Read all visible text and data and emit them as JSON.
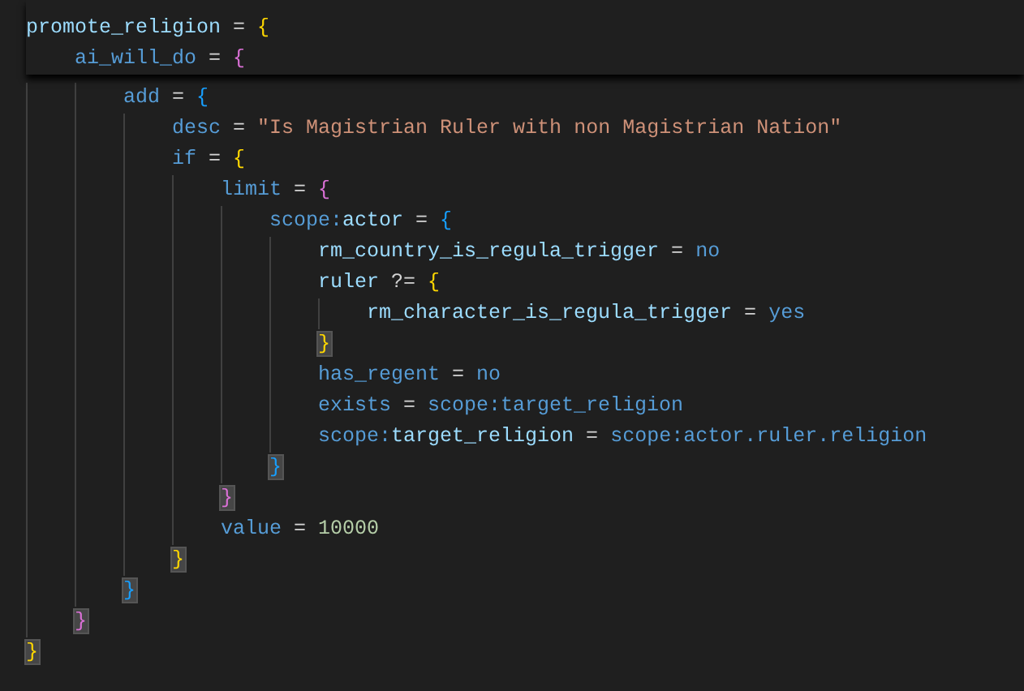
{
  "sticky_header": [
    [
      {
        "kind": "name",
        "text": "promote_religion"
      },
      {
        "kind": "op",
        "text": " = "
      },
      {
        "kind": "open",
        "text": "{"
      }
    ],
    [
      {
        "kind": "keyword",
        "text": "ai_will_do"
      },
      {
        "kind": "op",
        "text": " = "
      },
      {
        "kind": "open",
        "text": "{"
      }
    ]
  ],
  "lines": [
    [
      {
        "kind": "keyword",
        "text": "add"
      },
      {
        "kind": "op",
        "text": " = "
      },
      {
        "kind": "open",
        "text": "{"
      }
    ],
    [
      {
        "kind": "keyword",
        "text": "desc"
      },
      {
        "kind": "op",
        "text": " = "
      },
      {
        "kind": "string",
        "text": "\"Is Magistrian Ruler with non Magistrian Nation\""
      }
    ],
    [
      {
        "kind": "keyword",
        "text": "if"
      },
      {
        "kind": "op",
        "text": " = "
      },
      {
        "kind": "open",
        "text": "{"
      }
    ],
    [
      {
        "kind": "keyword",
        "text": "limit"
      },
      {
        "kind": "op",
        "text": " = "
      },
      {
        "kind": "open",
        "text": "{"
      }
    ],
    [
      {
        "kind": "keyword",
        "text": "scope:"
      },
      {
        "kind": "name",
        "text": "actor"
      },
      {
        "kind": "op",
        "text": " = "
      },
      {
        "kind": "open",
        "text": "{"
      }
    ],
    [
      {
        "kind": "name",
        "text": "rm_country_is_regula_trigger"
      },
      {
        "kind": "op",
        "text": " = "
      },
      {
        "kind": "keyword",
        "text": "no"
      }
    ],
    [
      {
        "kind": "name",
        "text": "ruler"
      },
      {
        "kind": "op",
        "text": " ?= "
      },
      {
        "kind": "open",
        "text": "{"
      }
    ],
    [
      {
        "kind": "name",
        "text": "rm_character_is_regula_trigger"
      },
      {
        "kind": "op",
        "text": " = "
      },
      {
        "kind": "keyword",
        "text": "yes"
      }
    ],
    [
      {
        "kind": "close",
        "text": "}",
        "highlighted": true
      }
    ],
    [
      {
        "kind": "keyword",
        "text": "has_regent"
      },
      {
        "kind": "op",
        "text": " = "
      },
      {
        "kind": "keyword",
        "text": "no"
      }
    ],
    [
      {
        "kind": "keyword",
        "text": "exists"
      },
      {
        "kind": "op",
        "text": " = "
      },
      {
        "kind": "keyword",
        "text": "scope:target_religion"
      }
    ],
    [
      {
        "kind": "keyword",
        "text": "scope:"
      },
      {
        "kind": "name",
        "text": "target_religion"
      },
      {
        "kind": "op",
        "text": " = "
      },
      {
        "kind": "keyword",
        "text": "scope:actor.ruler.religion"
      }
    ],
    [
      {
        "kind": "close",
        "text": "}",
        "highlighted": true
      }
    ],
    [
      {
        "kind": "close",
        "text": "}",
        "highlighted": true
      }
    ],
    [
      {
        "kind": "keyword",
        "text": "value"
      },
      {
        "kind": "op",
        "text": " = "
      },
      {
        "kind": "number",
        "text": "10000"
      }
    ],
    [
      {
        "kind": "close",
        "text": "}",
        "highlighted": true
      }
    ],
    [
      {
        "kind": "close",
        "text": "}",
        "highlighted": true
      }
    ],
    [
      {
        "kind": "close",
        "text": "}",
        "highlighted": true
      }
    ],
    [
      {
        "kind": "close",
        "text": "}",
        "highlighted": true
      }
    ]
  ]
}
